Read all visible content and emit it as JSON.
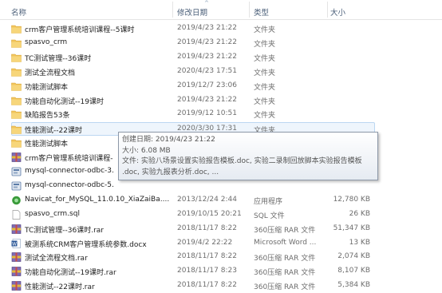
{
  "columns": {
    "name": "名称",
    "date": "修改日期",
    "type": "类型",
    "size": "大小"
  },
  "rows": [
    {
      "name": "crm客户管理系统培训课程--5课时",
      "date": "2019/4/23 21:22",
      "type": "文件夹",
      "size": "",
      "icon": "folder"
    },
    {
      "name": "spasvo_crm",
      "date": "2019/4/23 21:22",
      "type": "文件夹",
      "size": "",
      "icon": "folder"
    },
    {
      "name": "TC测试管理--36课时",
      "date": "2019/4/23 21:22",
      "type": "文件夹",
      "size": "",
      "icon": "folder"
    },
    {
      "name": "测试全流程文档",
      "date": "2020/4/23 17:51",
      "type": "文件夹",
      "size": "",
      "icon": "folder"
    },
    {
      "name": "功能测试脚本",
      "date": "2019/12/7 23:06",
      "type": "文件夹",
      "size": "",
      "icon": "folder"
    },
    {
      "name": "功能自动化测试--19课时",
      "date": "2019/4/23 21:22",
      "type": "文件夹",
      "size": "",
      "icon": "folder"
    },
    {
      "name": "缺陷报告53条",
      "date": "2019/9/12 10:51",
      "type": "文件夹",
      "size": "",
      "icon": "folder"
    },
    {
      "name": "性能测试--22课时",
      "date": "2020/3/30 17:31",
      "type": "文件夹",
      "size": "",
      "icon": "folder"
    },
    {
      "name": "性能测试脚本",
      "date": "",
      "type": "",
      "size": "",
      "icon": "folder"
    },
    {
      "name": "crm客户管理系统培训课程-",
      "date": "",
      "type": "",
      "size": "",
      "icon": "rar"
    },
    {
      "name": "mysql-connector-odbc-3.",
      "date": "",
      "type": "",
      "size": "",
      "icon": "msi"
    },
    {
      "name": "mysql-connector-odbc-5.",
      "date": "",
      "type": "",
      "size": "",
      "icon": "msi"
    },
    {
      "name": "Navicat_for_MySQL_11.0.10_XiaZaiBa....",
      "date": "2013/12/24 2:44",
      "type": "应用程序",
      "size": "12,780 KB",
      "icon": "app"
    },
    {
      "name": "spasvo_crm.sql",
      "date": "2019/10/15 20:21",
      "type": "SQL 文件",
      "size": "26 KB",
      "icon": "file"
    },
    {
      "name": "TC测试管理--36课时.rar",
      "date": "2018/11/17 8:22",
      "type": "360压缩 RAR 文件",
      "size": "51,347 KB",
      "icon": "rar"
    },
    {
      "name": "被测系统CRM客户管理系统参数.docx",
      "date": "2019/4/2 22:22",
      "type": "Microsoft Word ...",
      "size": "13 KB",
      "icon": "doc"
    },
    {
      "name": "测试全流程文档.rar",
      "date": "2018/11/17 8:22",
      "type": "360压缩 RAR 文件",
      "size": "2,074 KB",
      "icon": "rar"
    },
    {
      "name": "功能自动化测试--19课时.rar",
      "date": "2018/11/17 8:23",
      "type": "360压缩 RAR 文件",
      "size": "8,107 KB",
      "icon": "rar"
    },
    {
      "name": "性能测试--22课时.rar",
      "date": "2018/11/17 8:22",
      "type": "360压缩 RAR 文件",
      "size": "5,384 KB",
      "icon": "rar"
    }
  ],
  "tooltip": {
    "created": "创建日期: 2019/4/23 21:22",
    "size": "大小: 6.08 MB",
    "files_line1": "文件: 实验八场景设置实验报告模板.doc, 实验二录制回放脚本实验报告模板",
    "files_line2": ".doc, 实验九报表分析.doc, ..."
  },
  "colors": {
    "folder": "#f2c55c",
    "rar": "#7f6bb5",
    "msi": "#5b7ba8",
    "app": "#3a9b3a",
    "doc": "#2b5797"
  }
}
